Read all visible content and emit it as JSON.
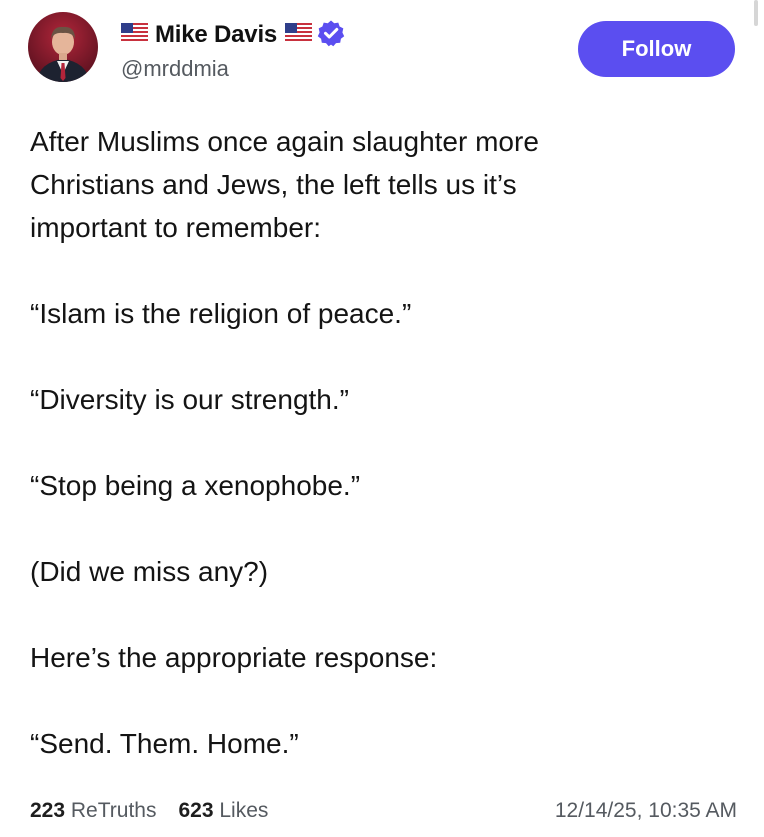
{
  "author": {
    "name": "Mike Davis",
    "handle": "@mrddmia",
    "flag_icon": "us-flag-icon",
    "verified_icon": "verified-badge-icon",
    "accent_color": "#5b4ef0"
  },
  "follow_button": {
    "label": "Follow"
  },
  "post": {
    "intro_lines": [
      "After Muslims once again slaughter more",
      "Christians and Jews, the left tells us it’s",
      "important to remember:"
    ],
    "quote_1": "“Islam is the religion of peace.”",
    "quote_2": "“Diversity is our strength.”",
    "quote_3": "“Stop being a xenophobe.”",
    "question": "(Did we miss any?)",
    "response_intro": "Here’s the appropriate response:",
    "response": "“Send. Them. Home.”"
  },
  "stats": {
    "retruths_count": "223",
    "retruths_label": "ReTruths",
    "likes_count": "623",
    "likes_label": "Likes",
    "timestamp": "12/14/25, 10:35 AM"
  }
}
